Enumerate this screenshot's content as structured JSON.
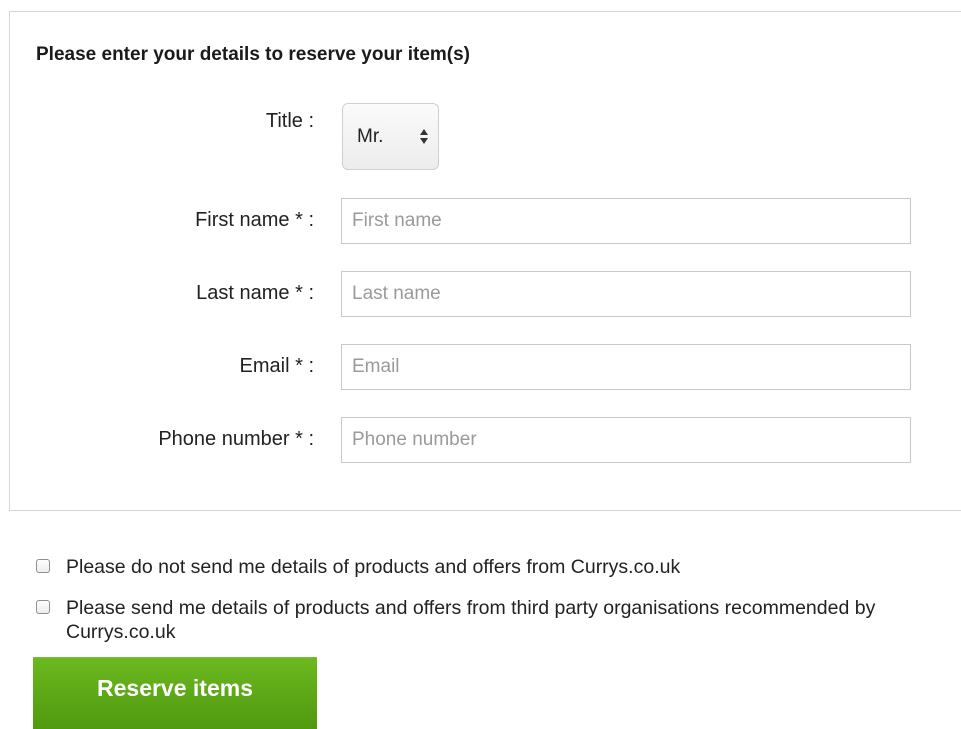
{
  "form": {
    "heading": "Please enter your details to reserve your item(s)",
    "title_field": {
      "label": "Title :",
      "selected_value": "Mr."
    },
    "first_name": {
      "label": "First name * :",
      "placeholder": "First name",
      "value": ""
    },
    "last_name": {
      "label": "Last name * :",
      "placeholder": "Last name",
      "value": ""
    },
    "email": {
      "label": "Email * :",
      "placeholder": "Email",
      "value": ""
    },
    "phone": {
      "label": "Phone number * :",
      "placeholder": "Phone number",
      "value": ""
    }
  },
  "consent": {
    "no_currys_offers": {
      "text": "Please do not send me details of products and offers from Currys.co.uk",
      "checked": false
    },
    "third_party_offers": {
      "text": "Please send me details of products and offers from third party organisations recommended by Currys.co.uk",
      "checked": false
    }
  },
  "actions": {
    "reserve_label": "Reserve items"
  },
  "colors": {
    "button_green": "#5aa816",
    "border_grey": "#c9c9c9"
  }
}
